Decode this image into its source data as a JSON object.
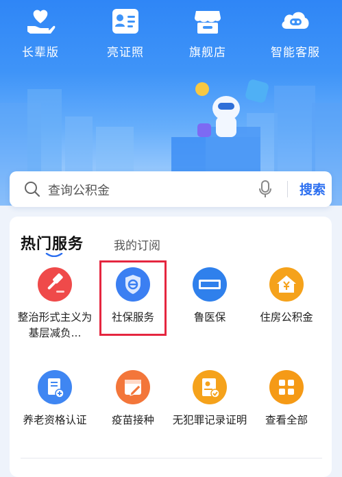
{
  "top_nav": [
    {
      "label": "长辈版",
      "icon": "heart-hand-icon"
    },
    {
      "label": "亮证照",
      "icon": "id-card-icon"
    },
    {
      "label": "旗舰店",
      "icon": "store-icon"
    },
    {
      "label": "智能客服",
      "icon": "robot-service-icon"
    }
  ],
  "search": {
    "placeholder": "查询公积金",
    "button": "搜索"
  },
  "tabs": {
    "active": "热门服务",
    "inactive": "我的订阅"
  },
  "services": [
    {
      "label": "整治形式主义为基层减负...",
      "icon": "gavel-icon",
      "color": "#ef4a4a"
    },
    {
      "label": "社保服务",
      "icon": "shield-icon",
      "color": "#3b7ff2"
    },
    {
      "label": "鲁医保",
      "icon": "chs-badge-icon",
      "color": "#2f80ec"
    },
    {
      "label": "住房公积金",
      "icon": "house-yuan-icon",
      "color": "#f5a21b"
    },
    {
      "label": "养老资格认证",
      "icon": "document-plus-icon",
      "color": "#3f86f2"
    },
    {
      "label": "疫苗接种",
      "icon": "calendar-edit-icon",
      "color": "#f3763a"
    },
    {
      "label": "无犯罪记录证明",
      "icon": "certificate-check-icon",
      "color": "#f5a21b"
    },
    {
      "label": "查看全部",
      "icon": "grid-icon",
      "color": "#f59a16"
    }
  ],
  "colors": {
    "brand_blue": "#2f86f6",
    "accent_blue": "#2c6ff0",
    "highlight_red": "#e5263f"
  }
}
